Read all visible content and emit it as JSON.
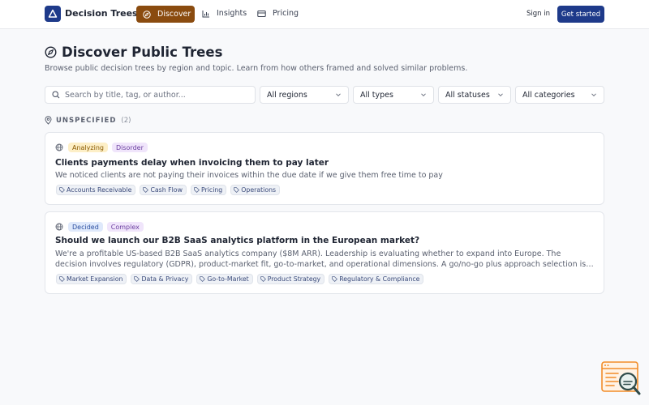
{
  "header": {
    "brand": "Decision Trees",
    "nav": [
      {
        "label": "Discover"
      },
      {
        "label": "Insights"
      },
      {
        "label": "Pricing"
      }
    ],
    "signin": "Sign in",
    "get_started": "Get started"
  },
  "page": {
    "title": "Discover Public Trees",
    "subtitle": "Browse public decision trees by region and topic. Learn from how others framed and solved similar problems."
  },
  "filters": {
    "search_placeholder": "Search by title, tag, or author...",
    "regions": "All regions",
    "types": "All types",
    "statuses": "All statuses",
    "categories": "All categories"
  },
  "section": {
    "label": "UNSPECIFIED",
    "count": "(2)"
  },
  "cards": [
    {
      "status": "Analyzing",
      "complexity": "Disorder",
      "title": "Clients payments delay when invoicing them to pay later",
      "description": "We noticed clients are not paying their invoices within the due date if we give them free time to pay",
      "tags": [
        "Accounts Receivable",
        "Cash Flow",
        "Pricing",
        "Operations"
      ]
    },
    {
      "status": "Decided",
      "complexity": "Complex",
      "title": "Should we launch our B2B SaaS analytics platform in the European market?",
      "description": "We're a profitable US-based B2B SaaS analytics company ($8M ARR). Leadership is evaluating whether to expand into Europe. The decision involves regulatory (GDPR), product-market fit, go-to-market, and operational dimensions. A go/no-go plus approach selection is needed before committing resources.",
      "tags": [
        "Market Expansion",
        "Data & Privacy",
        "Go-to-Market",
        "Product Strategy",
        "Regulatory & Compliance"
      ]
    }
  ],
  "icons": {
    "logo": "triangle-logo-icon",
    "discover": "compass-icon",
    "insights": "bar-chart-icon",
    "pricing": "credit-card-icon",
    "search": "search-icon",
    "select": "chevron-down-icon",
    "section": "map-pin-icon",
    "visibility": "globe-icon",
    "tag": "tag-icon",
    "widget": "feedback-search-icon"
  },
  "colors": {
    "primary": "#1e3a8a",
    "discover_active": "#8a4b0f",
    "analyzing_bg": "#fdefc7",
    "decided_bg": "#dfe9fb",
    "complexity_bg": "#f0e5fb"
  }
}
